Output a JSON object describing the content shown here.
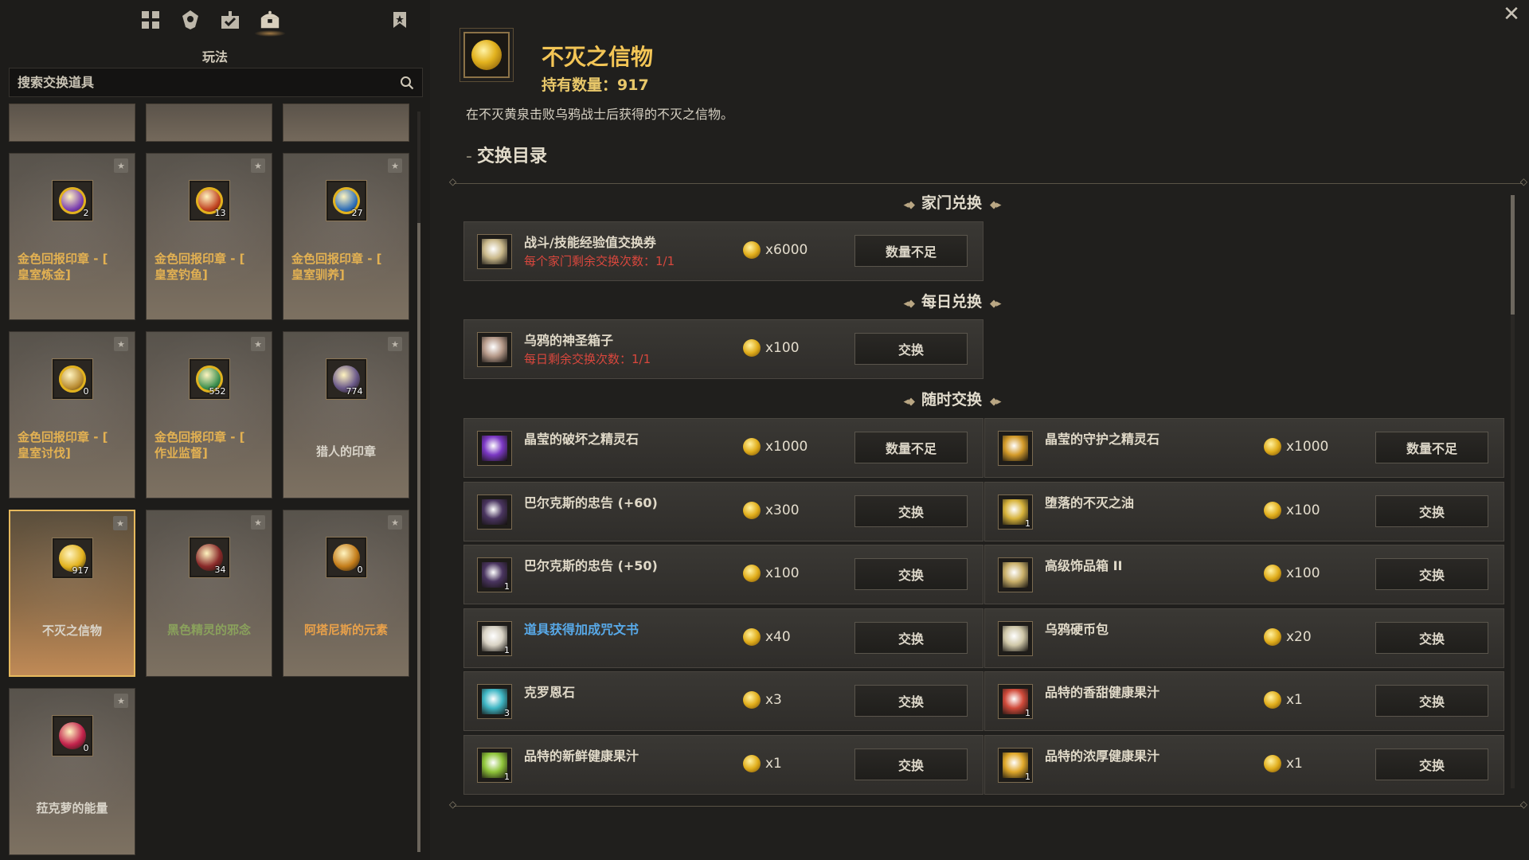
{
  "left": {
    "mode_label": "玩法",
    "search_placeholder": "搜索交换道具",
    "cards": [
      {
        "name": "金色回报印章 - [\n皇室炼金]",
        "count": "2",
        "style": "gold",
        "selected": false,
        "color": "#7b3fb0"
      },
      {
        "name": "金色回报印章 - [\n皇室钓鱼]",
        "count": "13",
        "style": "gold",
        "selected": false,
        "color": "#c0421f"
      },
      {
        "name": "金色回报印章 - [\n皇室驯养]",
        "count": "27",
        "style": "gold",
        "selected": false,
        "color": "#2f6fb8"
      },
      {
        "name": "金色回报印章 - [\n皇室讨伐]",
        "count": "0",
        "style": "gold",
        "selected": false,
        "color": "#b88a2f"
      },
      {
        "name": "金色回报印章 - [\n作业监督]",
        "count": "552",
        "style": "gold",
        "selected": false,
        "color": "#3b8f4e"
      },
      {
        "name": "猎人的印章",
        "count": "774",
        "style": "white",
        "selected": false,
        "color": "#6b5a8a"
      },
      {
        "name": "不灭之信物",
        "count": "917",
        "style": "white",
        "selected": true,
        "color": "#e2b21e"
      },
      {
        "name": "黑色精灵的邪念",
        "count": "34",
        "style": "green",
        "selected": false,
        "color": "#8a2a2a"
      },
      {
        "name": "阿塔尼斯的元素",
        "count": "0",
        "style": "orange",
        "selected": false,
        "color": "#c47d1a"
      },
      {
        "name": "菈克萝的能量",
        "count": "0",
        "style": "white",
        "selected": false,
        "color": "#c2234c"
      }
    ]
  },
  "right": {
    "title": "不灭之信物",
    "count_text": "持有数量：917",
    "description": "在不灭黄泉击败乌鸦战士后获得的不灭之信物。",
    "section_title": "交换目录",
    "categories": {
      "family": "家门兑换",
      "daily": "每日兑换",
      "anytime": "随时交换"
    },
    "family_items": [
      {
        "name": "战斗/技能经验值交换券",
        "sub": "每个家门剩余交换次数：1/1",
        "price": "x6000",
        "button": "数量不足",
        "icon_color": "#c9b88a",
        "qty": ""
      }
    ],
    "daily_items": [
      {
        "name": "乌鸦的神圣箱子",
        "sub": "每日剩余交换次数：1/1",
        "price": "x100",
        "button": "交换",
        "icon_color": "#b69a8a",
        "qty": ""
      }
    ],
    "anytime_items": [
      {
        "name": "晶莹的破坏之精灵石",
        "price": "x1000",
        "button": "数量不足",
        "icon_color": "#7b38c4",
        "qty": "",
        "blue": false
      },
      {
        "name": "晶莹的守护之精灵石",
        "price": "x1000",
        "button": "数量不足",
        "icon_color": "#d49b2a",
        "qty": "",
        "blue": false
      },
      {
        "name": "巴尔克斯的忠告 (+60)",
        "price": "x300",
        "button": "交换",
        "icon_color": "#4a3560",
        "qty": "",
        "blue": false
      },
      {
        "name": "堕落的不灭之油",
        "price": "x100",
        "button": "交换",
        "icon_color": "#d6b23a",
        "qty": "1",
        "blue": false
      },
      {
        "name": "巴尔克斯的忠告 (+50)",
        "price": "x100",
        "button": "交换",
        "icon_color": "#4a3560",
        "qty": "1",
        "blue": false
      },
      {
        "name": "高级饰品箱 II",
        "price": "x100",
        "button": "交换",
        "icon_color": "#c9b06a",
        "qty": "",
        "blue": false
      },
      {
        "name": "道具获得加成咒文书",
        "price": "x40",
        "button": "交换",
        "icon_color": "#d8d2c4",
        "qty": "1",
        "blue": true
      },
      {
        "name": "乌鸦硬币包",
        "price": "x20",
        "button": "交换",
        "icon_color": "#cfc7a8",
        "qty": "",
        "blue": false
      },
      {
        "name": "克罗恩石",
        "price": "x3",
        "button": "交换",
        "icon_color": "#3fb6c4",
        "qty": "3",
        "blue": false
      },
      {
        "name": "品特的香甜健康果汁",
        "price": "x1",
        "button": "交换",
        "icon_color": "#d04a3a",
        "qty": "1",
        "blue": false
      },
      {
        "name": "品特的新鲜健康果汁",
        "price": "x1",
        "button": "交换",
        "icon_color": "#8fc43a",
        "qty": "1",
        "blue": false
      },
      {
        "name": "品特的浓厚健康果汁",
        "price": "x1",
        "button": "交换",
        "icon_color": "#e0a82a",
        "qty": "1",
        "blue": false
      }
    ]
  }
}
